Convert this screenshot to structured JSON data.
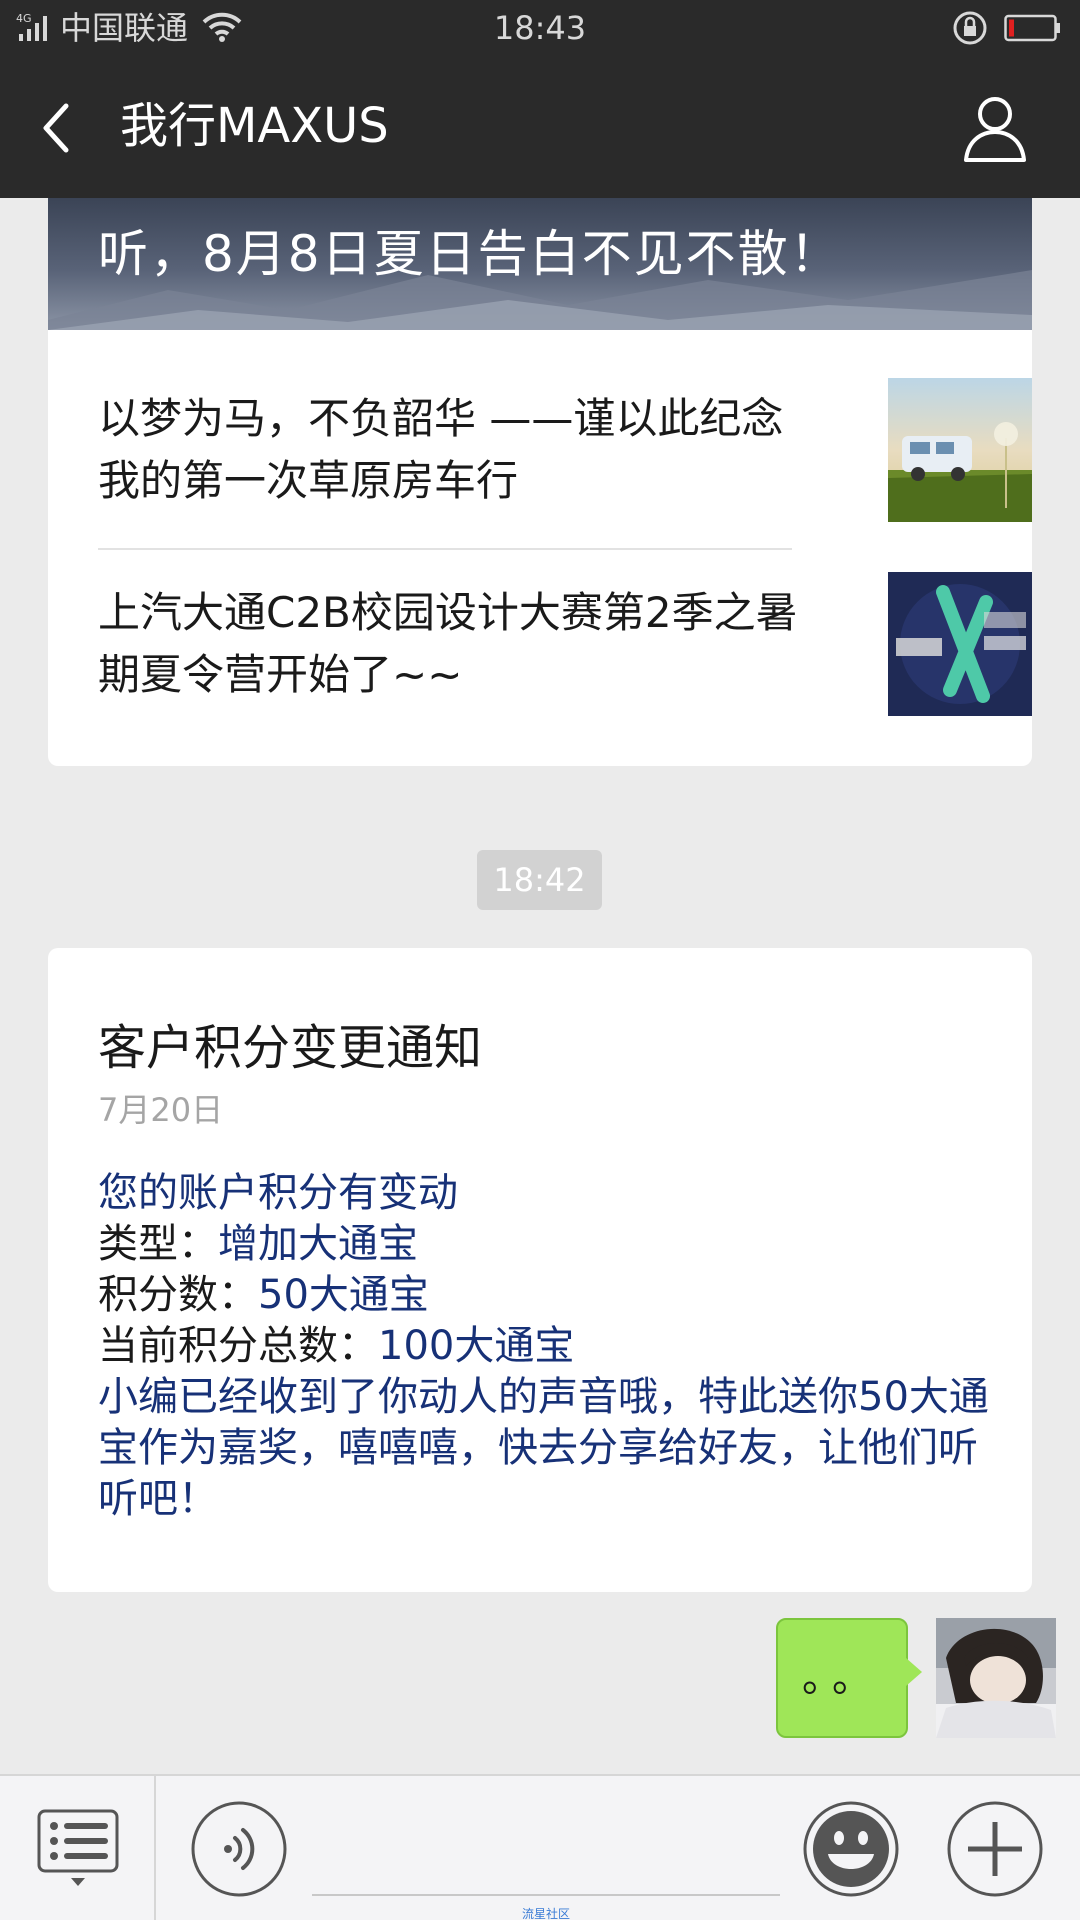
{
  "status_bar": {
    "network": "4G",
    "carrier": "中国联通",
    "time": "18:43",
    "icons": [
      "signal-icon",
      "wifi-icon",
      "rotation-lock-icon",
      "battery-icon"
    ],
    "battery_level": 0.1
  },
  "header": {
    "title": "我行MAXUS",
    "back_icon": "back-arrow-icon",
    "profile_icon": "person-icon"
  },
  "news_card": {
    "banner_text": "听，8月8日夏日告白不见不散！",
    "items": [
      {
        "title": "以梦为马，不负韶华 ——谨以此纪念我的第一次草原房车行",
        "thumb": "camper-van-in-grass-image"
      },
      {
        "title": "上汽大通C2B校园设计大赛第2季之暑期夏令营开始了~~",
        "thumb": "campus-recruitment-poster-image"
      }
    ]
  },
  "timestamp": "18:42",
  "notification": {
    "title": "客户积分变更通知",
    "date": "7月20日",
    "line1": "您的账户积分有变动",
    "type_label": "类型：",
    "type_value": "增加大通宝",
    "points_label": "积分数：",
    "points_value": "50大通宝",
    "total_label": "当前积分总数：",
    "total_value": "100大通宝",
    "remark": "小编已经收到了你动人的声音哦，特此送你50大通宝作为嘉奖，嘻嘻嘻，快去分享给好友，让他们听听吧！"
  },
  "sent_message": {
    "text": "。。",
    "avatar": "user-avatar-image"
  },
  "input_bar": {
    "hint": "流星社区",
    "icons": [
      "menu-list-icon",
      "voice-icon",
      "emoji-icon",
      "plus-icon"
    ]
  },
  "colors": {
    "bar_bg": "#2a2a2a",
    "chat_bg": "#ebebeb",
    "link_blue": "#173177",
    "bubble_green": "#9fe658"
  }
}
